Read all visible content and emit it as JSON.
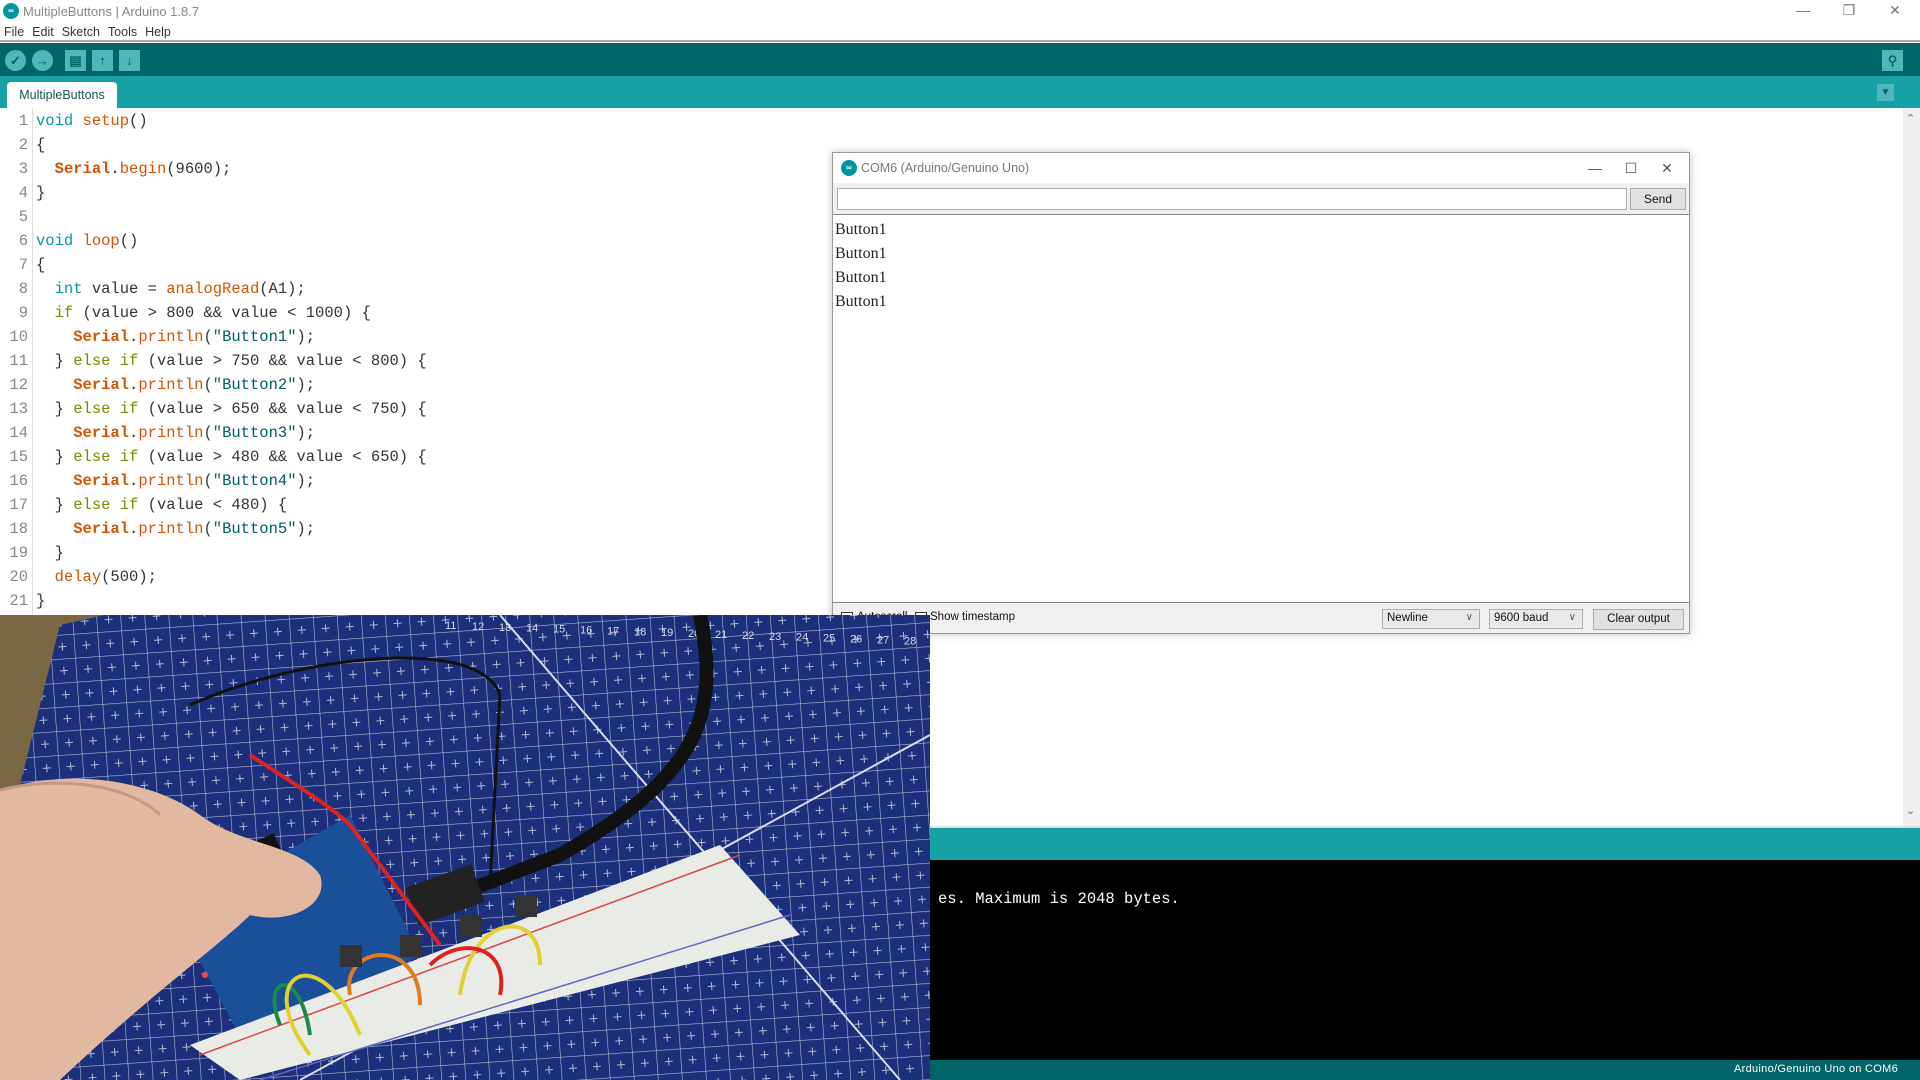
{
  "window": {
    "title": "MultipleButtons | Arduino 1.8.7",
    "controls": {
      "minimize": "—",
      "restore": "❐",
      "close": "✕"
    }
  },
  "menu": [
    "File",
    "Edit",
    "Sketch",
    "Tools",
    "Help"
  ],
  "toolbar": {
    "buttons": [
      {
        "name": "verify",
        "icon": "✓"
      },
      {
        "name": "upload",
        "icon": "→"
      },
      {
        "name": "new",
        "icon": "▤"
      },
      {
        "name": "open",
        "icon": "↑"
      },
      {
        "name": "save",
        "icon": "↓"
      }
    ],
    "serial_monitor_icon": "⚲"
  },
  "tabs": [
    {
      "label": "MultipleButtons",
      "active": true
    }
  ],
  "tab_menu_icon": "▼",
  "editor": {
    "line_numbers": [
      "1",
      "2",
      "3",
      "4",
      "5",
      "6",
      "7",
      "8",
      "9",
      "10",
      "11",
      "12",
      "13",
      "14",
      "15",
      "16",
      "17",
      "18",
      "19",
      "20",
      "21"
    ],
    "lines": [
      [
        {
          "t": "void",
          "c": "kw"
        },
        {
          "t": " "
        },
        {
          "t": "setup",
          "c": "fn"
        },
        {
          "t": "()"
        }
      ],
      [
        {
          "t": "{"
        }
      ],
      [
        {
          "t": "  "
        },
        {
          "t": "Serial",
          "c": "ser"
        },
        {
          "t": "."
        },
        {
          "t": "begin",
          "c": "fn"
        },
        {
          "t": "(9600);"
        }
      ],
      [
        {
          "t": "}"
        }
      ],
      [
        {
          "t": ""
        }
      ],
      [
        {
          "t": "void",
          "c": "kw"
        },
        {
          "t": " "
        },
        {
          "t": "loop",
          "c": "fn"
        },
        {
          "t": "()"
        }
      ],
      [
        {
          "t": "{"
        }
      ],
      [
        {
          "t": "  "
        },
        {
          "t": "int",
          "c": "kw"
        },
        {
          "t": " value = "
        },
        {
          "t": "analogRead",
          "c": "fn"
        },
        {
          "t": "(A1);"
        }
      ],
      [
        {
          "t": "  "
        },
        {
          "t": "if",
          "c": "cf"
        },
        {
          "t": " (value > 800 && value < 1000) {"
        }
      ],
      [
        {
          "t": "    "
        },
        {
          "t": "Serial",
          "c": "ser"
        },
        {
          "t": "."
        },
        {
          "t": "println",
          "c": "fn"
        },
        {
          "t": "("
        },
        {
          "t": "\"Button1\"",
          "c": "str"
        },
        {
          "t": ");"
        }
      ],
      [
        {
          "t": "  } "
        },
        {
          "t": "else",
          "c": "cf"
        },
        {
          "t": " "
        },
        {
          "t": "if",
          "c": "cf"
        },
        {
          "t": " (value > 750 && value < 800) {"
        }
      ],
      [
        {
          "t": "    "
        },
        {
          "t": "Serial",
          "c": "ser"
        },
        {
          "t": "."
        },
        {
          "t": "println",
          "c": "fn"
        },
        {
          "t": "("
        },
        {
          "t": "\"Button2\"",
          "c": "str"
        },
        {
          "t": ");"
        }
      ],
      [
        {
          "t": "  } "
        },
        {
          "t": "else",
          "c": "cf"
        },
        {
          "t": " "
        },
        {
          "t": "if",
          "c": "cf"
        },
        {
          "t": " (value > 650 && value < 750) {"
        }
      ],
      [
        {
          "t": "    "
        },
        {
          "t": "Serial",
          "c": "ser"
        },
        {
          "t": "."
        },
        {
          "t": "println",
          "c": "fn"
        },
        {
          "t": "("
        },
        {
          "t": "\"Button3\"",
          "c": "str"
        },
        {
          "t": ");"
        }
      ],
      [
        {
          "t": "  } "
        },
        {
          "t": "else",
          "c": "cf"
        },
        {
          "t": " "
        },
        {
          "t": "if",
          "c": "cf"
        },
        {
          "t": " (value > 480 && value < 650) {"
        }
      ],
      [
        {
          "t": "    "
        },
        {
          "t": "Serial",
          "c": "ser"
        },
        {
          "t": "."
        },
        {
          "t": "println",
          "c": "fn"
        },
        {
          "t": "("
        },
        {
          "t": "\"Button4\"",
          "c": "str"
        },
        {
          "t": ");"
        }
      ],
      [
        {
          "t": "  } "
        },
        {
          "t": "else",
          "c": "cf"
        },
        {
          "t": " "
        },
        {
          "t": "if",
          "c": "cf"
        },
        {
          "t": " (value < 480) {"
        }
      ],
      [
        {
          "t": "    "
        },
        {
          "t": "Serial",
          "c": "ser"
        },
        {
          "t": "."
        },
        {
          "t": "println",
          "c": "fn"
        },
        {
          "t": "("
        },
        {
          "t": "\"Button5\"",
          "c": "str"
        },
        {
          "t": ");"
        }
      ],
      [
        {
          "t": "  }"
        }
      ],
      [
        {
          "t": "  "
        },
        {
          "t": "delay",
          "c": "fn"
        },
        {
          "t": "(500);"
        }
      ],
      [
        {
          "t": "}"
        }
      ]
    ],
    "scroll_up_icon": "⌃",
    "scroll_down_icon": "⌄"
  },
  "console": {
    "text": "es. Maximum is 2048 bytes."
  },
  "status": {
    "board": "Arduino/Genuino Uno on COM6"
  },
  "serial_monitor": {
    "title": "COM6 (Arduino/Genuino Uno)",
    "input_value": "",
    "send_label": "Send",
    "output_lines": [
      "Button1",
      "Button1",
      "Button1",
      "Button1"
    ],
    "autoscroll_label": "Autoscroll",
    "autoscroll_checked": false,
    "timestamp_label": "Show timestamp",
    "timestamp_checked": false,
    "line_ending": "Newline",
    "baud": "9600 baud",
    "clear_label": "Clear output"
  },
  "photo": {
    "description": "Photo of Arduino Uno wired to breadboard with push buttons on blue cutting mat",
    "mat_ruler_numbers": [
      "11",
      "12",
      "13",
      "14",
      "15",
      "16",
      "17",
      "18",
      "19",
      "20",
      "21",
      "22",
      "23",
      "24",
      "25",
      "26",
      "27",
      "28"
    ]
  },
  "colors": {
    "teal_dark": "#006468",
    "teal": "#17A1A5",
    "teal_light": "#4DB7BB",
    "keyword": "#00979C",
    "control": "#728E00",
    "serial": "#D35400",
    "string": "#005C5F"
  }
}
